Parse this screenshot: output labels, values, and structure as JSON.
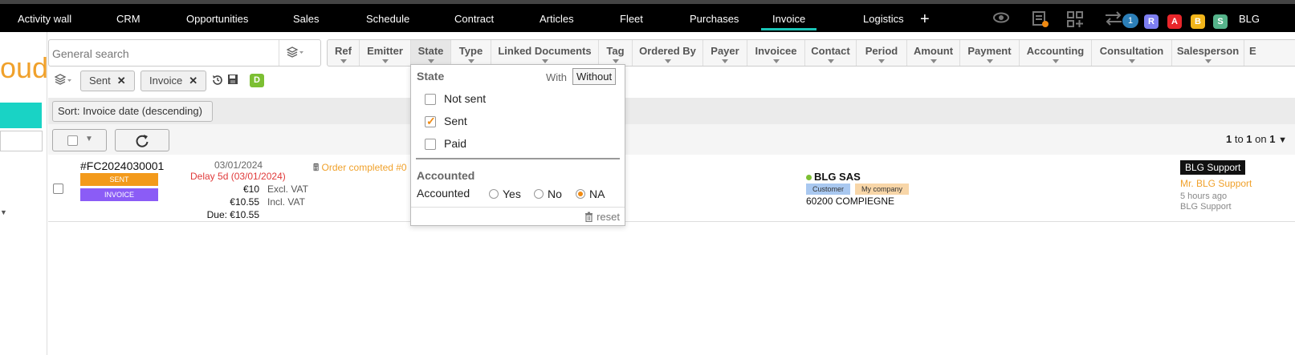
{
  "topnav": {
    "items": [
      "Activity wall",
      "CRM",
      "Opportunities",
      "Sales",
      "Schedule",
      "Contract",
      "Articles",
      "Fleet",
      "Purchases",
      "Invoice",
      "Logistics"
    ],
    "active": "Invoice",
    "plus": "+",
    "notification_count": "1",
    "user_badges": [
      {
        "letter": "R",
        "color": "#7d7ef0"
      },
      {
        "letter": "A",
        "color": "#e8262b"
      },
      {
        "letter": "B",
        "color": "#f2b51a"
      },
      {
        "letter": "S",
        "color": "#55b38a"
      }
    ],
    "user_label": "BLG"
  },
  "left": {
    "logo_fragment": "oud"
  },
  "search": {
    "placeholder": "General search"
  },
  "filter_columns": [
    "Ref",
    "Emitter",
    "State",
    "Type",
    "Linked Documents",
    "Tag",
    "Ordered By",
    "Payer",
    "Invoicee",
    "Contact",
    "Period",
    "Amount",
    "Payment",
    "Accounting",
    "Consultation",
    "Salesperson",
    "E"
  ],
  "active_filters": {
    "chips": [
      "Sent",
      "Invoice"
    ],
    "remove_glyph": "✕",
    "draft_badge": "D"
  },
  "sort": {
    "label": "Sort: Invoice date (descending)"
  },
  "pager": {
    "from": "1",
    "to_word": "to",
    "to": "1",
    "on_word": "on",
    "total": "1"
  },
  "row": {
    "ref": "#FC2024030001",
    "status_tag": "SENT",
    "status_color": "#f39a1b",
    "type_tag": "INVOICE",
    "type_color": "#8b5cf6",
    "date": "03/01/2024",
    "delay": "Delay 5d (03/01/2024)",
    "amount_excl": "€10",
    "amount_excl_label": "Excl. VAT",
    "amount_incl": "€10.55",
    "amount_incl_label": "Incl. VAT",
    "due": "Due: €10.55",
    "order_text": "Order completed #0",
    "company": "BLG SAS",
    "company_tags": [
      "Customer",
      "My company"
    ],
    "city": "60200 COMPIEGNE",
    "support_badge": "BLG Support",
    "support_link": "Mr. BLG Support",
    "support_time": "5 hours ago",
    "support_by": "BLG Support"
  },
  "state_panel": {
    "title": "State",
    "with": "With",
    "without": "Without",
    "options": [
      {
        "label": "Not sent",
        "checked": false
      },
      {
        "label": "Sent",
        "checked": true
      },
      {
        "label": "Paid",
        "checked": false
      }
    ],
    "accounted_title": "Accounted",
    "accounted_label": "Accounted",
    "radios": [
      {
        "label": "Yes",
        "selected": false
      },
      {
        "label": "No",
        "selected": false
      },
      {
        "label": "NA",
        "selected": true
      }
    ],
    "reset": "reset"
  }
}
